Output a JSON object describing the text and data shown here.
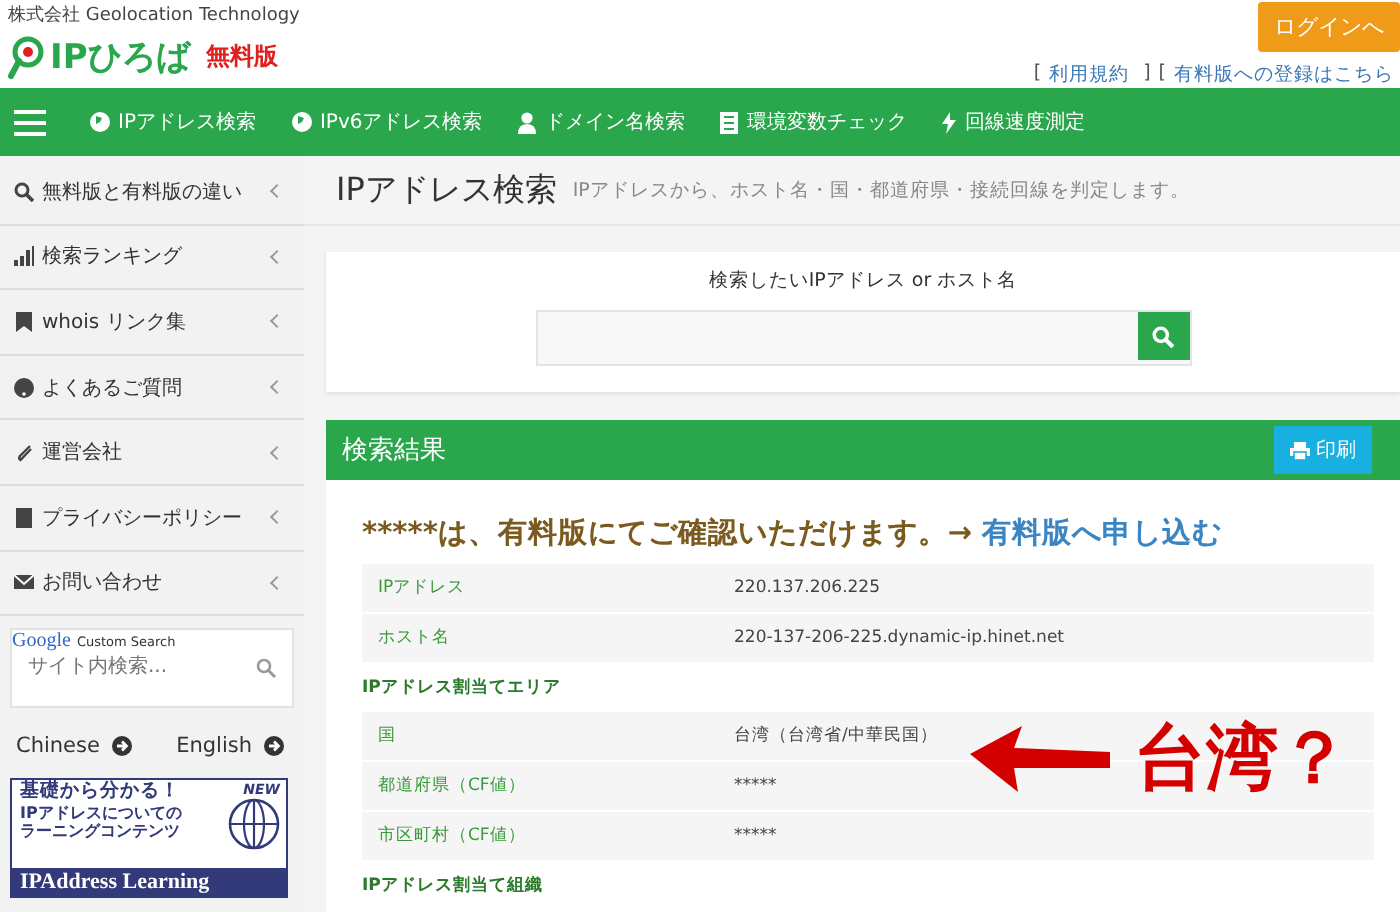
{
  "header": {
    "company": "株式会社 Geolocation Technology",
    "logo": "IPひろば",
    "edition": "無料版",
    "login_button": "ログインへ",
    "links": [
      {
        "open": "[",
        "text": "利用規約",
        "close": "]"
      },
      {
        "open": "[",
        "text": "有料版への登録はこちら"
      }
    ]
  },
  "nav": [
    "IPアドレス検索",
    "IPv6アドレス検索",
    "ドメイン名検索",
    "環境変数チェック",
    "回線速度測定"
  ],
  "sidebar": {
    "items": [
      "無料版と有料版の違い",
      "検索ランキング",
      "whois リンク集",
      "よくあるご質問",
      "運営会社",
      "プライバシーポリシー",
      "お問い合わせ"
    ],
    "search": {
      "brand": "Google",
      "brand_caption": "Custom Search",
      "placeholder": "サイト内検索..."
    },
    "languages": [
      "Chinese",
      "English"
    ],
    "banner": {
      "lines": [
        "基礎から分かる！",
        "IPアドレスについての",
        "ラーニングコンテンツ"
      ],
      "badge": "NEW",
      "footer": "IPAddress Learning"
    }
  },
  "page": {
    "title": "IPアドレス検索",
    "subtitle": "IPアドレスから、ホスト名・国・都道府県・接続回線を判定します。"
  },
  "search_form": {
    "label": "検索したいIPアドレス or ホスト名"
  },
  "results": {
    "title": "検索結果",
    "print_button": "印刷",
    "notice": "*****は、有料版にてご確認いただけます。→",
    "notice_link": "有料版へ申し込む",
    "rows": [
      {
        "kind": "field",
        "label": "IPアドレス",
        "value": "220.137.206.225"
      },
      {
        "kind": "field",
        "label": "ホスト名",
        "value": "220-137-206-225.dynamic-ip.hinet.net"
      },
      {
        "kind": "section",
        "label": "IPアドレス割当てエリア"
      },
      {
        "kind": "field",
        "label": "国",
        "value": "台湾（台湾省/中華民国）"
      },
      {
        "kind": "field",
        "label": "都道府県（CF値）",
        "value": "*****"
      },
      {
        "kind": "field",
        "label": "市区町村（CF値）",
        "value": "*****"
      },
      {
        "kind": "section",
        "label": "IPアドレス割当て組織"
      }
    ],
    "annotation": "台湾？"
  }
}
